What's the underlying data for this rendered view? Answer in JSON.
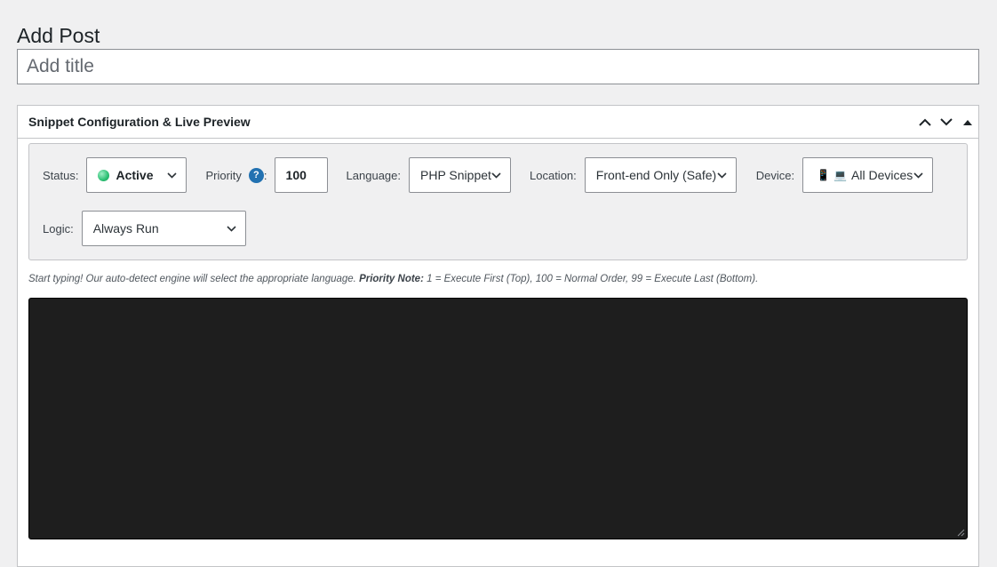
{
  "page": {
    "title": "Add Post"
  },
  "title_field": {
    "placeholder": "Add title",
    "value": ""
  },
  "metabox": {
    "title": "Snippet Configuration & Live Preview",
    "actions": [
      "chevron-up-icon",
      "chevron-down-icon",
      "toggle-arrow-icon"
    ]
  },
  "config": {
    "status": {
      "label": "Status:",
      "value": "Active",
      "indicator_color": "#2bbf73"
    },
    "priority": {
      "label": "Priority",
      "colon": ":",
      "help": "?",
      "value": "100"
    },
    "language": {
      "label": "Language:",
      "value": "PHP Snippet"
    },
    "location": {
      "label": "Location:",
      "value": "Front-end Only (Safe)"
    },
    "device": {
      "label": "Device:",
      "icon_mobile": "📱",
      "icon_desktop": "💻",
      "value": "All Devices"
    },
    "logic": {
      "label": "Logic:",
      "value": "Always Run"
    }
  },
  "hint": {
    "lead": "Start typing! Our auto-detect engine will select the appropriate language. ",
    "bold": "Priority Note:",
    "rest": " 1 = Execute First (Top), 100 = Normal Order, 99 = Execute Last (Bottom)."
  },
  "editor": {
    "content": "",
    "background": "#1e1e1e"
  },
  "colors": {
    "accent": "#2271b1",
    "page_bg": "#f0f0f1",
    "border": "#c3c4c7"
  }
}
